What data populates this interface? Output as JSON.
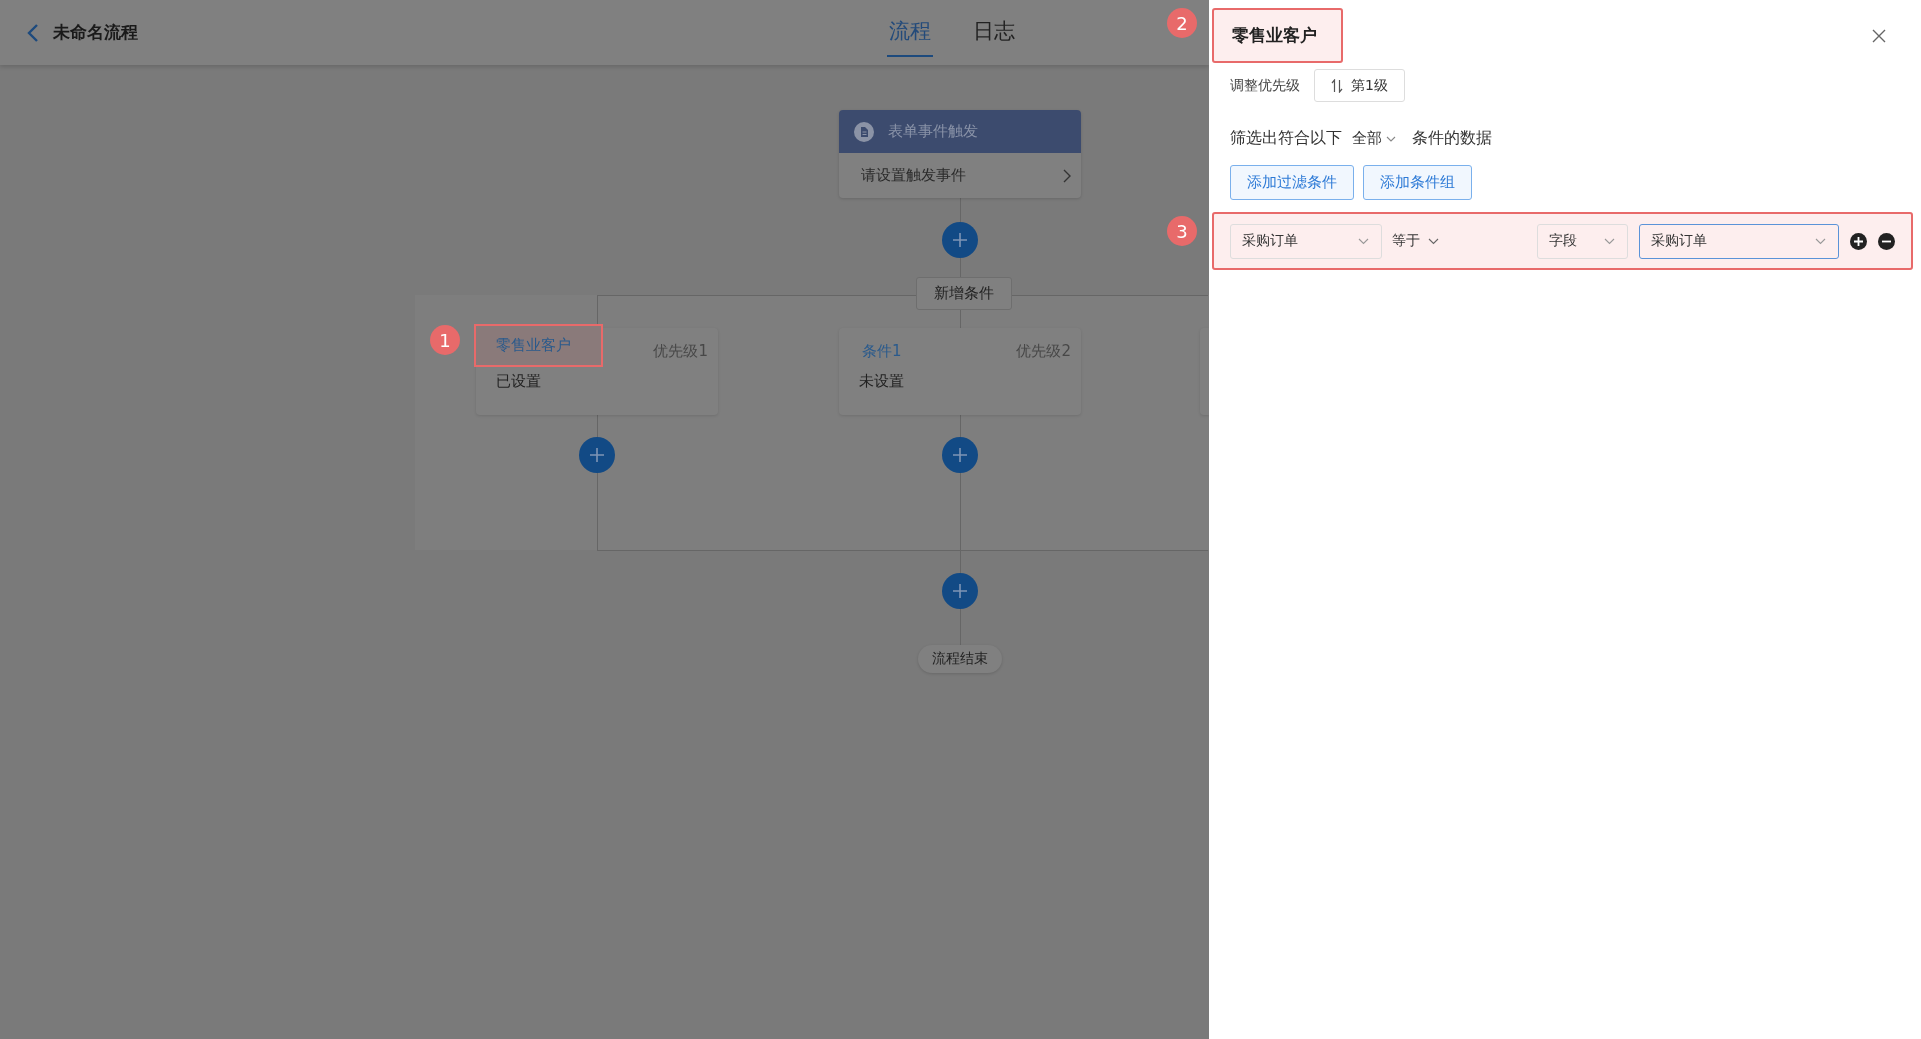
{
  "header": {
    "title": "未命名流程",
    "tabs": [
      {
        "label": "流程",
        "selected": true
      },
      {
        "label": "日志",
        "selected": false
      }
    ]
  },
  "flow": {
    "trigger": {
      "title": "表单事件触发",
      "action": "请设置触发事件"
    },
    "add_condition": "新增条件",
    "branches": [
      {
        "name": "零售业客户",
        "priority": "优先级1",
        "status": "已设置",
        "annotation": "1"
      },
      {
        "name": "条件1",
        "priority": "优先级2",
        "status": "未设置"
      }
    ],
    "end": "流程结束"
  },
  "panel": {
    "title": "零售业客户",
    "annotation": "2",
    "priority_label": "调整优先级",
    "priority_button": "第1级",
    "filter": {
      "prefix": "筛选出符合以下",
      "match": "全部",
      "suffix": "条件的数据"
    },
    "buttons": [
      "添加过滤条件",
      "添加条件组"
    ],
    "conditions": [
      {
        "field": "采购订单",
        "operator": "等于",
        "value_type": "字段",
        "value": "采购订单",
        "annotation": "3"
      }
    ]
  }
}
